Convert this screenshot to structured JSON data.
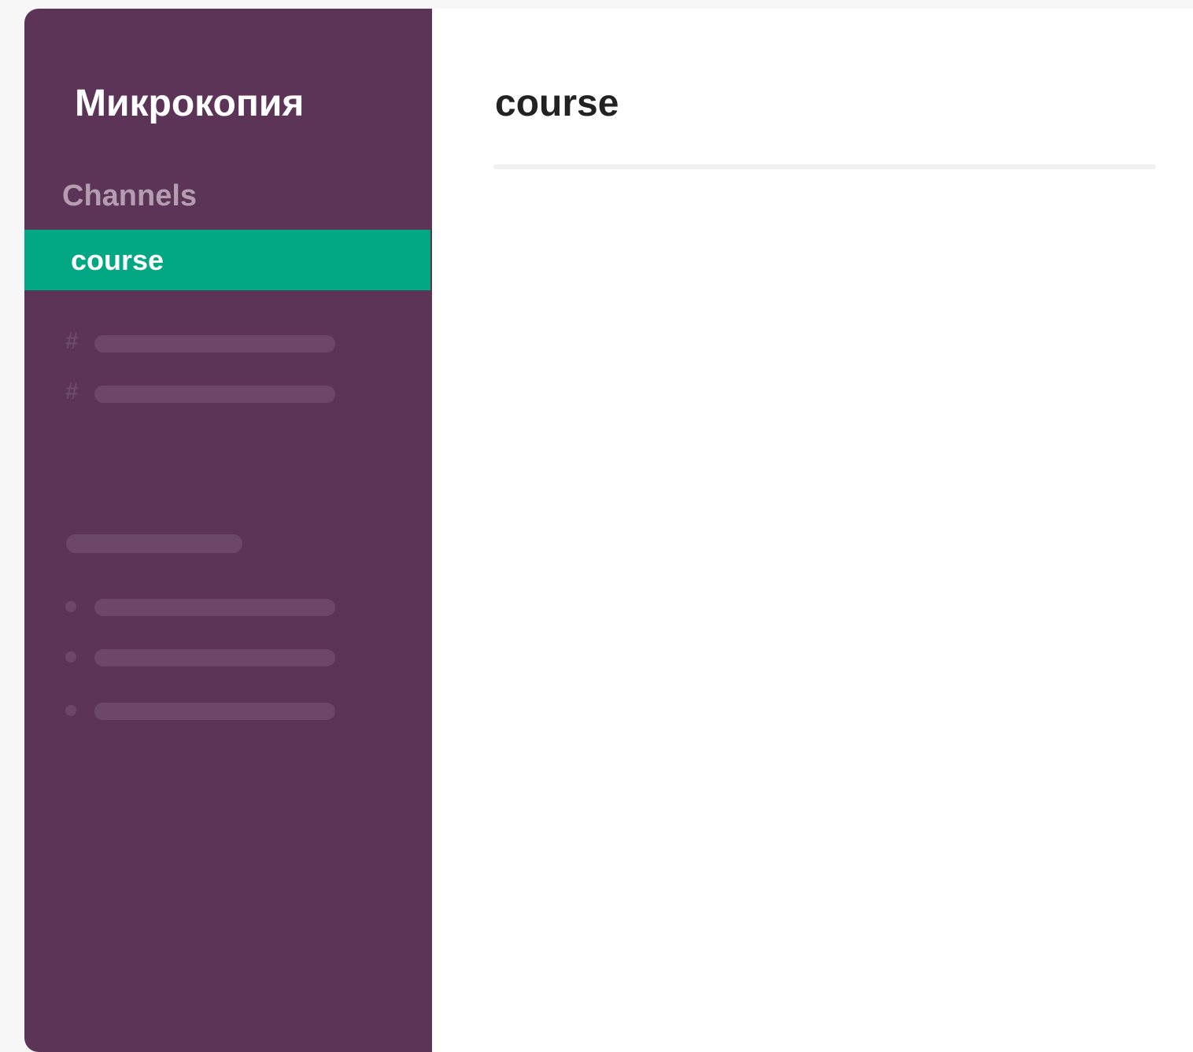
{
  "workspace": {
    "name": "Микрокопия"
  },
  "sidebar": {
    "section_label": "Channels",
    "active_channel": "course",
    "placeholder_channels": [
      {
        "icon": "hash-icon",
        "glyph": "#"
      },
      {
        "icon": "hash-icon",
        "glyph": "#"
      }
    ],
    "placeholder_direct_messages": [
      {
        "icon": "status-dot-icon"
      },
      {
        "icon": "status-dot-icon"
      },
      {
        "icon": "status-dot-icon"
      }
    ]
  },
  "main": {
    "channel_title": "course"
  },
  "colors": {
    "sidebar_bg": "#5c3458",
    "active_channel_bg": "#02a884",
    "skeleton": "#6d4769",
    "section_label": "#b49db1",
    "title_text": "#222222"
  }
}
